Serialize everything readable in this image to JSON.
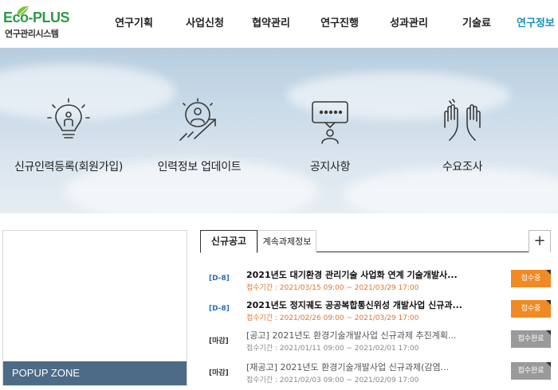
{
  "header": {
    "logo": {
      "brand": "Eco-PLUS",
      "subtitle": "연구관리시스템"
    },
    "nav": [
      {
        "label": "연구기획",
        "active": false
      },
      {
        "label": "사업신청",
        "active": false
      },
      {
        "label": "협약관리",
        "active": false
      },
      {
        "label": "연구진행",
        "active": false
      },
      {
        "label": "성과관리",
        "active": false
      },
      {
        "label": "기술료",
        "active": false
      },
      {
        "label": "연구정보",
        "active": true
      }
    ]
  },
  "hero": {
    "items": [
      {
        "label": "신규인력등록(회원가입)",
        "icon": "lightbulb-person-icon"
      },
      {
        "label": "인력정보 업데이트",
        "icon": "person-growth-arrow-icon"
      },
      {
        "label": "공지사항",
        "icon": "presenter-speech-icon"
      },
      {
        "label": "수요조사",
        "icon": "raised-hands-icon"
      }
    ]
  },
  "popup": {
    "label": "POPUP ZONE"
  },
  "notice": {
    "tabs": [
      {
        "label": "신규공고",
        "active": true
      },
      {
        "label": "계속과제정보",
        "active": false
      }
    ],
    "more_label": "+",
    "rows": [
      {
        "dday": "[D-8]",
        "title": "2021년도 대기환경 관리기술 사업화 연계 기술개발사...",
        "period_label": "접수기간 : ",
        "period": "2021/03/15 09:00 ~ 2021/03/29 17:00",
        "status": "접수중",
        "open": true
      },
      {
        "dday": "[D-8]",
        "title": "2021년도 정지궤도 공공복합통신위성 개발사업 신규과...",
        "period_label": "접수기간 : ",
        "period": "2021/02/26 09:00 ~ 2021/03/29 17:00",
        "status": "접수중",
        "open": true
      },
      {
        "dday": "[마감]",
        "title": "[공고] 2021년도 환경기술개발사업 신규과제 추진계획...",
        "period_label": "접수기간 : ",
        "period": "2021/01/11 09:00 ~ 2021/02/01 17:00",
        "status": "접수완료",
        "open": false
      },
      {
        "dday": "[마감]",
        "title": "[재공고] 2021년도 환경기술개발사업 신규과제(감염...",
        "period_label": "접수기간 : ",
        "period": "2021/02/03 09:00 ~ 2021/02/09 17:00",
        "status": "접수완료",
        "open": false
      }
    ]
  },
  "colors": {
    "brand_green": "#2d9b46",
    "nav_active": "#1a8fb8",
    "dday_open": "#2a6fb0",
    "dday_closed": "#333333",
    "period_open": "#e0752d",
    "status_open": "#f08a24",
    "status_closed": "#9a9a9a",
    "popup_bar": "#4d6a86"
  }
}
